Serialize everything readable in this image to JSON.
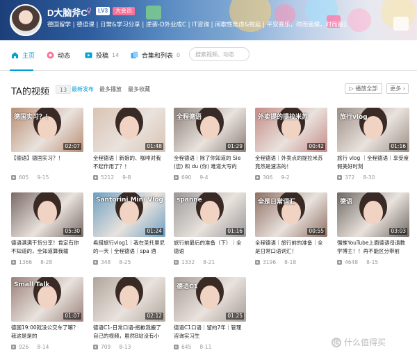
{
  "profile": {
    "username": "D大脑斧C",
    "level": "LV3",
    "vip": "大会员",
    "sign": "德国留学 | 德语课 | 日常&学习分享 | 逆袭-D外业成C | IT咨询 | 间歇性焦虑&拖延 | 平安喜乐，时而强健，时而最温"
  },
  "nav": {
    "home": "主页",
    "dynamic": "动态",
    "submissions": "投稿",
    "submissions_count": "14",
    "collections": "合集和列表",
    "collections_count": "0",
    "search_placeholder": "搜索视频、动态"
  },
  "section": {
    "title": "TA的视频",
    "count": "13",
    "sort": [
      "最新发布",
      "最多播放",
      "最多收藏"
    ],
    "play_all": "▷ 播放全部",
    "more": "更多 ›"
  },
  "videos": [
    {
      "title": "【德语】德国实习？！",
      "views": "605",
      "date": "9-15",
      "duration": "02:07",
      "thumb_text": "德国实习？！",
      "color": "#b98d72"
    },
    {
      "title": "全程德语｜新娘的、咖啡对我不起作用了？！",
      "views": "5212",
      "date": "9-8",
      "duration": "01:48",
      "thumb_text": "",
      "color": "#d9c3b2"
    },
    {
      "title": "全程德语｜除了你知道的 Sie(您) 和 du (你) 难道大写的",
      "views": "690",
      "date": "9-4",
      "duration": "01:29",
      "thumb_text": "全程德语",
      "color": "#8c8078"
    },
    {
      "title": "全程德语｜外卖点的提拉米苏竟然是速冻的！",
      "views": "306",
      "date": "9-2",
      "duration": "00:42",
      "thumb_text": "外卖提的提拉米苏",
      "color": "#c58a86"
    },
    {
      "title": "旅行 vlog ｜全程德语｜享受度假美好时刻",
      "views": "372",
      "date": "8-30",
      "duration": "01:16",
      "thumb_text": "旅行vlog",
      "color": "#9d8f86"
    },
    {
      "title": "德语满满干货分享！肯定有你不知道的，全知道算我输",
      "views": "1366",
      "date": "8-28",
      "duration": "05:30",
      "thumb_text": "",
      "color": "#7a6a66"
    },
    {
      "title": "希腊旅行vlog1｜我在圣托里尼的一天｜全程德语｜spa 酒",
      "views": "348",
      "date": "8-25",
      "duration": "01:24",
      "thumb_text": "Santorini Mini Vlog 1",
      "color": "#6da0c2"
    },
    {
      "title": "旅行前最后的准备（下）｜全德语",
      "views": "1332",
      "date": "8-21",
      "duration": "01:16",
      "thumb_text": "spanne",
      "color": "#999897"
    },
    {
      "title": "全程德语｜旅行前的准备｜全是日常口语词汇！",
      "views": "3196",
      "date": "8-18",
      "duration": "00:55",
      "thumb_text": "全是日常词汇",
      "color": "#8e6f64"
    },
    {
      "title": "强推YouTube上面德语母语教学博主！！再不能区分带前",
      "views": "4648",
      "date": "8-15",
      "duration": "03:03",
      "thumb_text": "德语",
      "color": "#6f6863"
    },
    {
      "title": "德国19:00就没公交车了嘛？我这是是的",
      "views": "926",
      "date": "8-14",
      "duration": "01:07",
      "thumb_text": "Small Talk",
      "color": "#9a8179"
    },
    {
      "title": "德语C1-日常口语-抱歉我搬了自己的视频，虽然B站没有小",
      "views": "709",
      "date": "8-13",
      "duration": "02:12",
      "thumb_text": "",
      "color": "#b0a59a"
    },
    {
      "title": "德语C1口语｜留的7年｜管理咨询实习生",
      "views": "645",
      "date": "8-11",
      "duration": "01:25",
      "thumb_text": "德语C1",
      "color": "#a89c96"
    }
  ],
  "watermark": "什么值得买",
  "watermark_icon": "值",
  "colors": {
    "accent": "#00a1d6",
    "vip": "#fb7299"
  }
}
